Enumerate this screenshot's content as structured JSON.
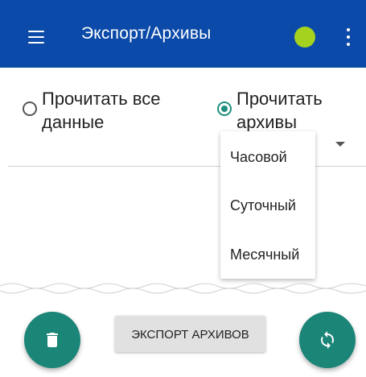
{
  "appbar": {
    "title": "Экспорт/Архивы",
    "menu_icon": "hamburger-menu-icon",
    "status_color": "#a5d11f",
    "more_icon": "more-vert-icon",
    "color": "#0b4aa8"
  },
  "options": {
    "read_all": {
      "label_line1": "Прочитать все",
      "label_line2": "данные",
      "selected": false
    },
    "read_archives": {
      "label_line1": "Прочитать",
      "label_line2": "архивы",
      "selected": true
    }
  },
  "archive_type_dropdown": {
    "items": [
      "Часовой",
      "Суточный",
      "Месячный"
    ]
  },
  "actions": {
    "delete_icon": "trash-icon",
    "export_label": "ЭКСПОРТ АРХИВОВ",
    "sync_icon": "sync-icon",
    "accent": "#1b8577"
  }
}
